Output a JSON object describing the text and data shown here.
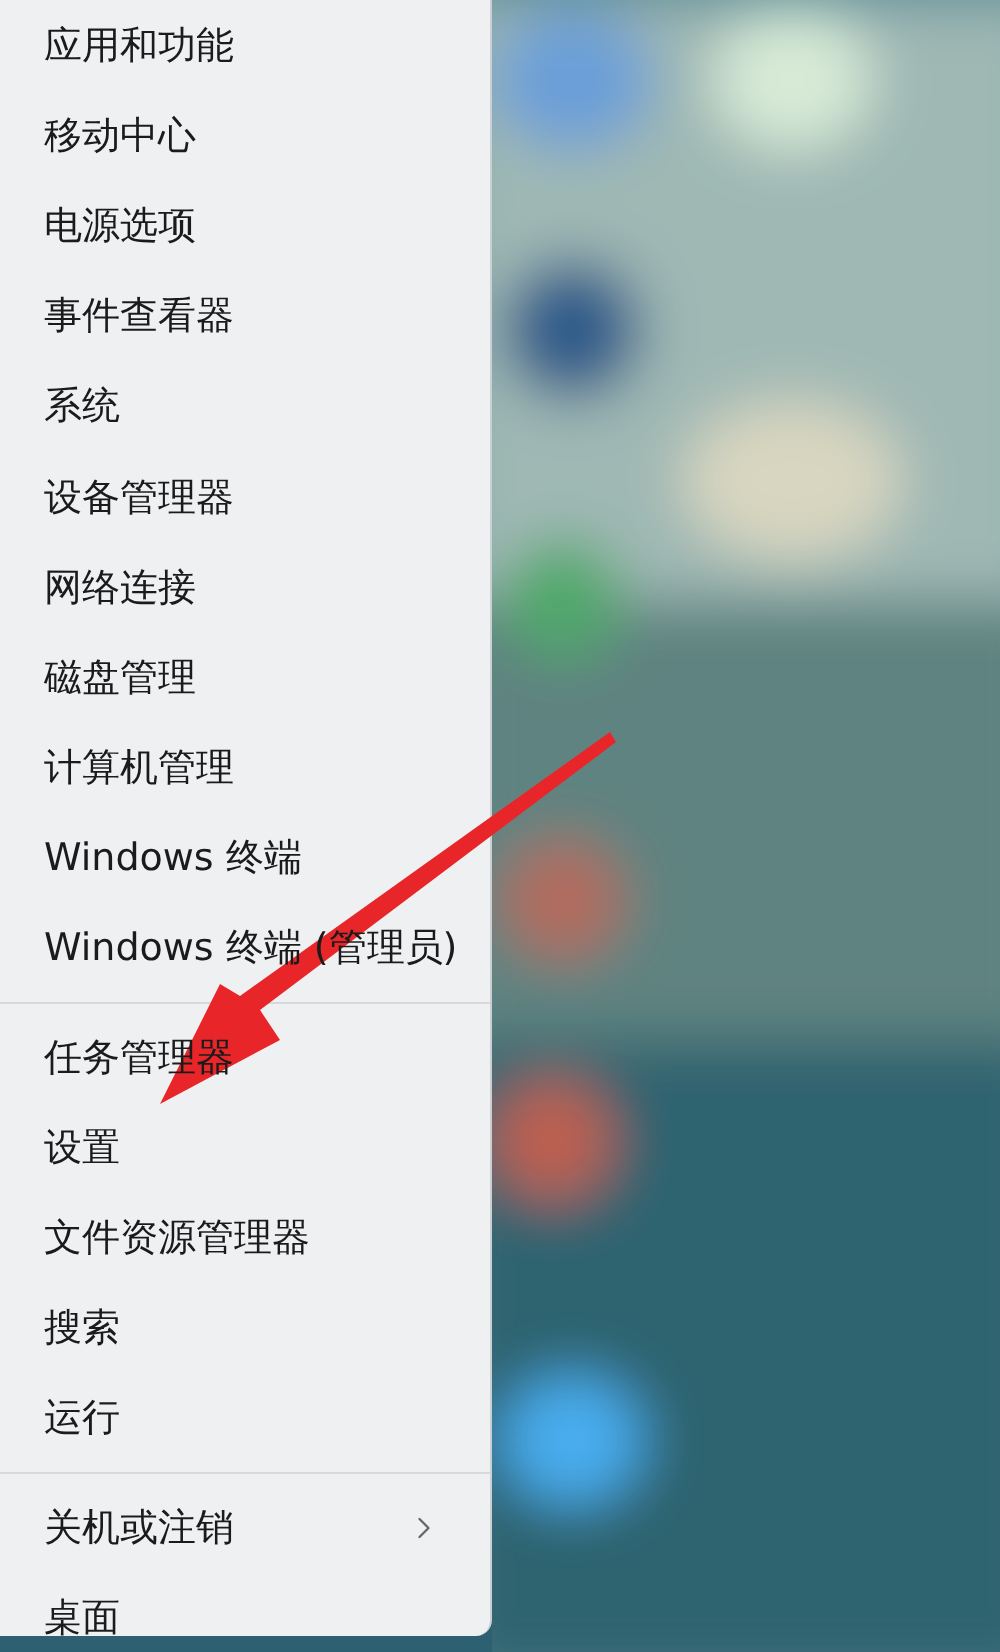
{
  "menu": {
    "groups": [
      {
        "items": [
          {
            "label": "应用和功能",
            "has_submenu": false
          },
          {
            "label": "移动中心",
            "has_submenu": false
          },
          {
            "label": "电源选项",
            "has_submenu": false
          },
          {
            "label": "事件查看器",
            "has_submenu": false
          },
          {
            "label": "系统",
            "has_submenu": false
          },
          {
            "label": "设备管理器",
            "has_submenu": false
          },
          {
            "label": "网络连接",
            "has_submenu": false
          },
          {
            "label": "磁盘管理",
            "has_submenu": false
          },
          {
            "label": "计算机管理",
            "has_submenu": false
          },
          {
            "label": "Windows 终端",
            "has_submenu": false
          },
          {
            "label": "Windows 终端 (管理员)",
            "has_submenu": false
          }
        ]
      },
      {
        "items": [
          {
            "label": "任务管理器",
            "has_submenu": false
          },
          {
            "label": "设置",
            "has_submenu": false
          },
          {
            "label": "文件资源管理器",
            "has_submenu": false
          },
          {
            "label": "搜索",
            "has_submenu": false
          },
          {
            "label": "运行",
            "has_submenu": false
          }
        ]
      },
      {
        "items": [
          {
            "label": "关机或注销",
            "has_submenu": true
          },
          {
            "label": "桌面",
            "has_submenu": false
          }
        ]
      }
    ]
  },
  "annotation": {
    "kind": "arrow"
  }
}
